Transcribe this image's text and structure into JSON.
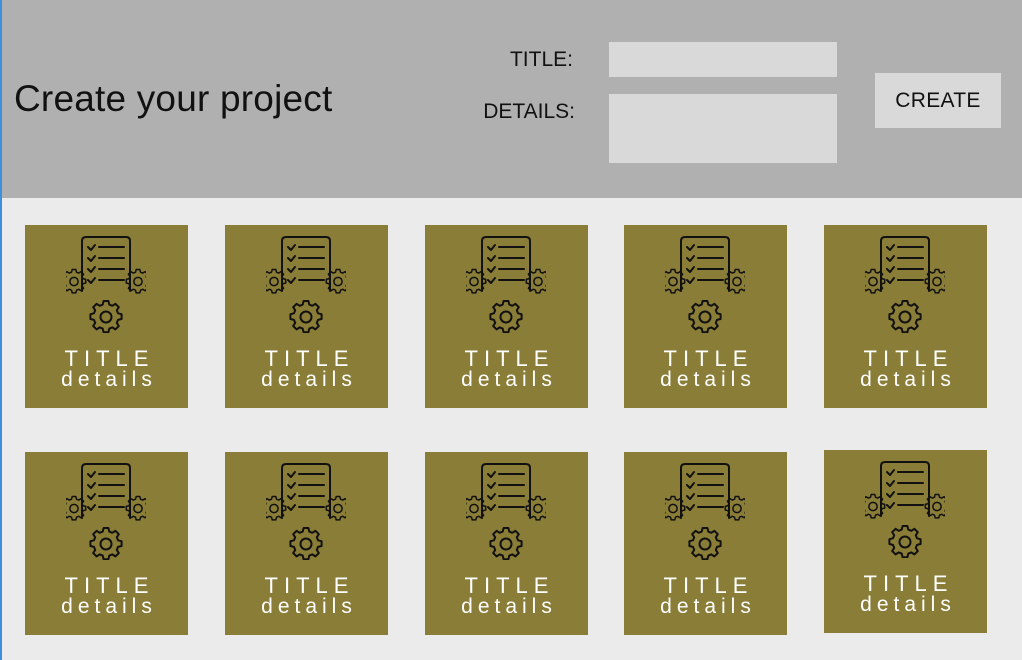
{
  "colors": {
    "page_bg": "#ebebeb",
    "header_bg": "#b0b0b0",
    "field_bg": "#d9d9d9",
    "card_bg": "#8a7d37"
  },
  "header": {
    "title": "Create your project",
    "title_label": "TITLE:",
    "details_label": "DETAILS:",
    "title_value": "",
    "details_value": "",
    "create_label": "CREATE"
  },
  "cards": [
    {
      "title": "TITLE",
      "details": "details",
      "icon": "checklist-gears-icon"
    },
    {
      "title": "TITLE",
      "details": "details",
      "icon": "checklist-gears-icon"
    },
    {
      "title": "TITLE",
      "details": "details",
      "icon": "checklist-gears-icon"
    },
    {
      "title": "TITLE",
      "details": "details",
      "icon": "checklist-gears-icon"
    },
    {
      "title": "TITLE",
      "details": "details",
      "icon": "checklist-gears-icon"
    },
    {
      "title": "TITLE",
      "details": "details",
      "icon": "checklist-gears-icon"
    },
    {
      "title": "TITLE",
      "details": "details",
      "icon": "checklist-gears-icon"
    },
    {
      "title": "TITLE",
      "details": "details",
      "icon": "checklist-gears-icon"
    },
    {
      "title": "TITLE",
      "details": "details",
      "icon": "checklist-gears-icon"
    },
    {
      "title": "TITLE",
      "details": "details",
      "icon": "checklist-gears-icon"
    }
  ]
}
